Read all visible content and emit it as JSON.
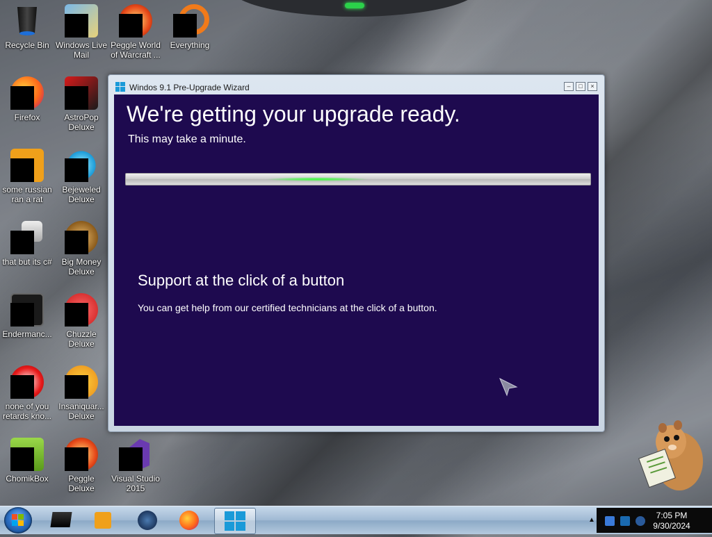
{
  "desktop": {
    "icons": [
      {
        "label": "Recycle Bin",
        "icon": "recycle-bin-icon"
      },
      {
        "label": "Windows Live Mail",
        "icon": "windows-live-mail-icon"
      },
      {
        "label": "Peggle World of Warcraft ...",
        "icon": "peggle-icon"
      },
      {
        "label": "Everything",
        "icon": "everything-search-icon"
      },
      {
        "label": "Firefox",
        "icon": "firefox-icon"
      },
      {
        "label": "AstroPop Deluxe",
        "icon": "astropop-icon"
      },
      {
        "label": "some russian ran a rat",
        "icon": "rat-icon"
      },
      {
        "label": "Bejeweled Deluxe",
        "icon": "bejeweled-icon"
      },
      {
        "label": "that but its c#",
        "icon": "windows-stack-icon"
      },
      {
        "label": "Big Money Deluxe",
        "icon": "big-money-icon"
      },
      {
        "label": "Endermanc...",
        "icon": "terminal-icon"
      },
      {
        "label": "Chuzzle Deluxe",
        "icon": "chuzzle-icon"
      },
      {
        "label": "none of you retards kno...",
        "icon": "orb-icon"
      },
      {
        "label": "Insaniquar... Deluxe",
        "icon": "insaniquarium-icon"
      },
      {
        "label": "ChomikBox",
        "icon": "chomikbox-icon"
      },
      {
        "label": "Peggle Deluxe",
        "icon": "peggle-deluxe-icon"
      },
      {
        "label": "Visual Studio 2015",
        "icon": "visual-studio-icon"
      }
    ]
  },
  "window": {
    "title": "Windos 9.1 Pre-Upgrade Wizard",
    "heading": "We're getting your upgrade ready.",
    "subheading": "This may take a minute.",
    "support_title": "Support at the click of a button",
    "support_text": "You can get help from our certified technicians at the click of a button."
  },
  "taskbar": {
    "items": [
      "start-orb",
      "media-center-icon",
      "media-player-icon",
      "steam-icon",
      "firefox-icon",
      "windows-wizard-icon"
    ],
    "clock": {
      "time": "7:05 PM",
      "date": "9/30/2024"
    }
  }
}
